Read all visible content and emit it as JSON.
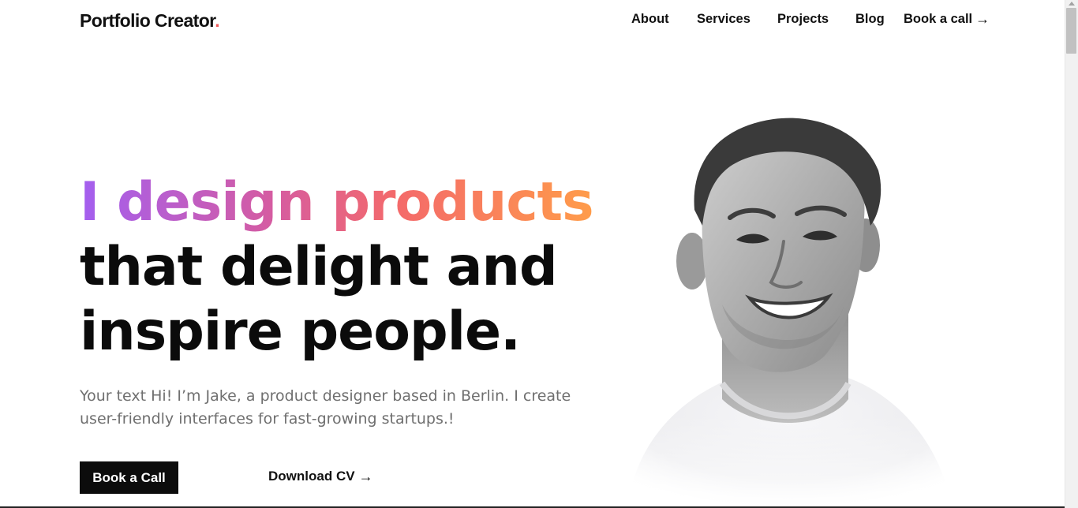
{
  "header": {
    "logo_text": "Portfolio Creator",
    "logo_dot": ".",
    "nav": {
      "about": "About",
      "services": "Services",
      "projects": "Projects",
      "blog": "Blog",
      "book_call": "Book a call",
      "book_call_icon": "arrow-right-icon"
    }
  },
  "hero": {
    "headline_gradient": "I design products",
    "headline_line2": "that delight and",
    "headline_line3": "inspire people.",
    "subtext": "Your text Hi! I’m Jake, a product designer based in Berlin. I create user-friendly interfaces for fast-growing startups.!",
    "primary_button": "Book a Call",
    "secondary_link": "Download CV",
    "secondary_icon": "arrow-right-icon"
  },
  "colors": {
    "accent_dot": "#ef5a5a",
    "gradient": [
      "#a35ff0",
      "#d65ca0",
      "#f46a6a",
      "#ff9c4a"
    ],
    "button_bg": "#0c0c0c"
  }
}
